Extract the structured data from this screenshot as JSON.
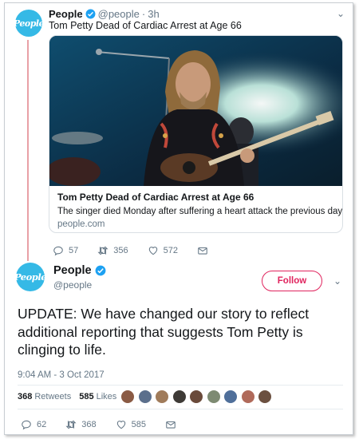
{
  "parent_tweet": {
    "avatar_text": "People",
    "name": "People",
    "handle": "@people",
    "separator": "·",
    "time": "3h",
    "text": "Tom Petty Dead of Cardiac Arrest at Age 66",
    "card": {
      "title": "Tom Petty Dead of Cardiac Arrest at Age 66",
      "description": "The singer died Monday after suffering a heart attack the previous day",
      "domain": "people.com"
    },
    "actions": {
      "replies": "57",
      "retweets": "356",
      "likes": "572"
    }
  },
  "main_tweet": {
    "avatar_text": "People",
    "name": "People",
    "handle": "@people",
    "follow_label": "Follow",
    "text": "UPDATE: We have changed our story to reflect additional reporting that suggests Tom Petty is clinging to life.",
    "timestamp": "9:04 AM - 3 Oct 2017",
    "retweet_count": "368",
    "retweet_label": "Retweets",
    "like_count": "585",
    "like_label": "Likes",
    "liker_colors": [
      "#8a5a44",
      "#5b6f8c",
      "#a07b5a",
      "#3e3a36",
      "#6a4a3a",
      "#7d8a72",
      "#4f6f9a",
      "#b06a5a",
      "#6b5040"
    ],
    "actions": {
      "replies": "62",
      "retweets": "368",
      "likes": "585"
    }
  },
  "colors": {
    "accent_blue": "#1da1f2",
    "follow_red": "#e0245e",
    "brand_people": "#35b9e6"
  }
}
